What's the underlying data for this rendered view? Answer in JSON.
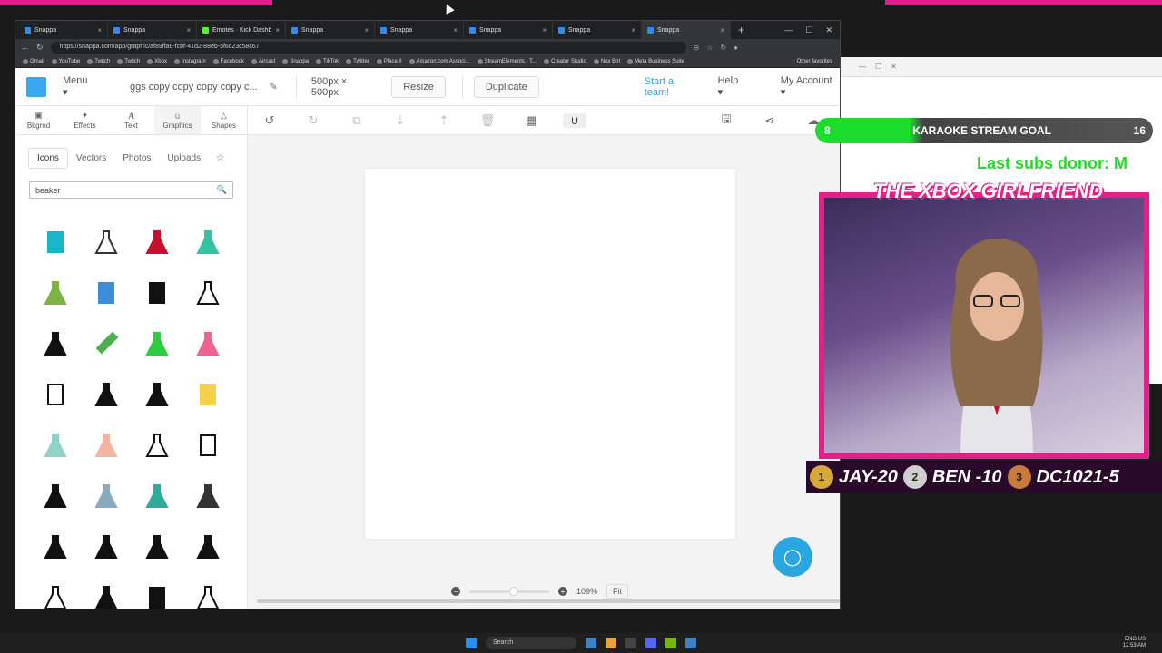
{
  "browser": {
    "tabs": [
      {
        "label": "Snappa",
        "icon": "snappa-favicon"
      },
      {
        "label": "Snappa",
        "icon": "snappa-favicon"
      },
      {
        "label": "Emotes · Kick Dashboard",
        "icon": "kick-favicon"
      },
      {
        "label": "Snappa",
        "icon": "snappa-favicon"
      },
      {
        "label": "Snappa",
        "icon": "snappa-favicon"
      },
      {
        "label": "Snappa",
        "icon": "snappa-favicon"
      },
      {
        "label": "Snappa",
        "icon": "snappa-favicon"
      },
      {
        "label": "Snappa",
        "icon": "snappa-favicon"
      }
    ],
    "url": "https://snappa.com/app/graphic/af89ffa6-fcbf-41d2-88eb-5f6c23c58c67",
    "bookmarks": [
      "Gmail",
      "YouTube",
      "Twitch",
      "Twitch",
      "Xbox",
      "Instagram",
      "Facebook",
      "Aircast",
      "Snappa",
      "TikTok",
      "Twitter",
      "Place it",
      "Amazon.com Associ...",
      "StreamElements · T...",
      "Creator Studio",
      "Nox Bot",
      "Meta Business Suite"
    ],
    "other_favorites": "Other favorites"
  },
  "app": {
    "menu": "Menu",
    "doc_name": "ggs copy copy copy copy c...",
    "size": "500px × 500px",
    "resize": "Resize",
    "duplicate": "Duplicate",
    "start_team": "Start a team!",
    "help": "Help",
    "account": "My Account",
    "accent": "#2ba6e0"
  },
  "tools": [
    {
      "label": "Bkgrnd",
      "icon": "image-icon"
    },
    {
      "label": "Effects",
      "icon": "wand-icon"
    },
    {
      "label": "Text",
      "icon": "text-icon"
    },
    {
      "label": "Graphics",
      "icon": "smile-icon"
    },
    {
      "label": "Shapes",
      "icon": "triangle-icon"
    }
  ],
  "sidebar": {
    "tabs": [
      "Icons",
      "Vectors",
      "Photos",
      "Uploads"
    ],
    "active_tab": "Icons",
    "search_value": "beaker"
  },
  "zoom": {
    "level": "109%",
    "fit": "Fit",
    "slider_fraction": 0.5
  },
  "stream": {
    "goal_current": "8",
    "goal_title": "KARAOKE STREAM GOAL",
    "goal_target": "16",
    "goal_fraction": 0.5,
    "subs_donor": "Last subs donor: M",
    "cam_title": "THE XBOX GIRLFRIEND",
    "leaders": [
      {
        "rank": "1",
        "text": "JAY-20"
      },
      {
        "rank": "2",
        "text": "BEN -10"
      },
      {
        "rank": "3",
        "text": "DC1021-5"
      }
    ]
  },
  "taskbar": {
    "search": "Search",
    "lang": "ENG US",
    "time": "12:53 AM",
    "date": "2025-01-08"
  }
}
